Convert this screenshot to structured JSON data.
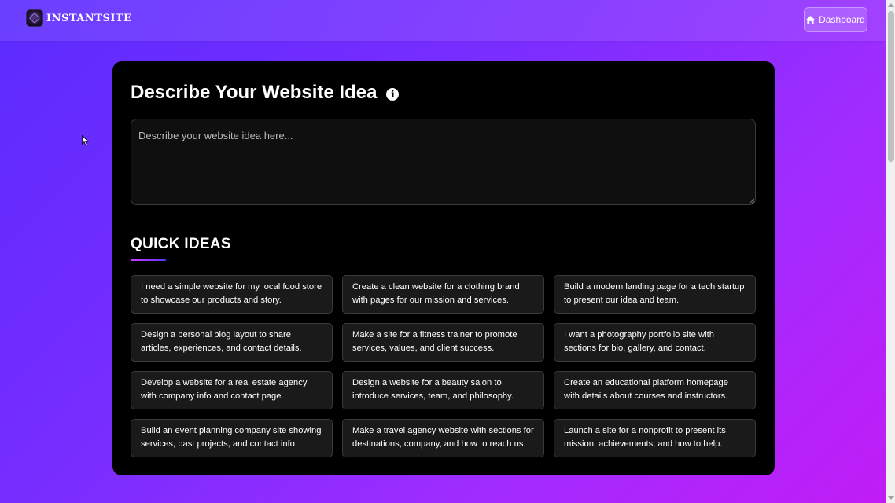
{
  "header": {
    "brand": "INSTANTSITE",
    "dashboard_label": "Dashboard"
  },
  "main": {
    "title": "Describe Your Website Idea",
    "input_placeholder": "Describe your website idea here...",
    "quick_ideas_title": "QUICK IDEAS",
    "ideas": [
      "I need a simple website for my local food store to showcase our products and story.",
      "Create a clean website for a clothing brand with pages for our mission and services.",
      "Build a modern landing page for a tech startup to present our idea and team.",
      "Design a personal blog layout to share articles, experiences, and contact details.",
      "Make a site for a fitness trainer to promote services, values, and client success.",
      "I want a photography portfolio site with sections for bio, gallery, and contact.",
      "Develop a website for a real estate agency with company info and contact page.",
      "Design a website for a beauty salon to introduce services, team, and philosophy.",
      "Create an educational platform homepage with details about courses and instructors.",
      "Build an event planning company site showing services, past projects, and contact info.",
      "Make a travel agency website with sections for destinations, company, and how to reach us.",
      "Launch a site for a nonprofit to present its mission, achievements, and how to help."
    ]
  },
  "icons": {
    "dashboard": "home-icon",
    "title_info": "info-icon"
  },
  "colors": {
    "background_start": "#5b2bff",
    "background_end": "#c21cf5",
    "card": "#000000",
    "idea_card": "#1a1a1a",
    "accent_gradient_start": "#c53dff",
    "accent_gradient_end": "#5b35ff"
  }
}
